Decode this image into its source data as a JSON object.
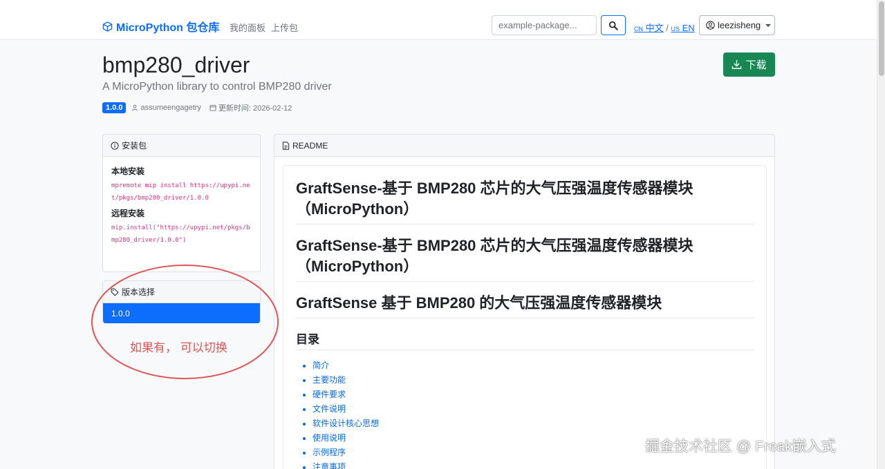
{
  "navbar": {
    "brand": "MicroPython 包仓库",
    "links": [
      "我的面板",
      "上传包"
    ],
    "search_placeholder": "example-package...",
    "lang_cn_code": "CN",
    "lang_cn_label": "中文",
    "lang_sep": "/",
    "lang_us_code": "US",
    "lang_us_label": "EN",
    "username": "leezisheng"
  },
  "package": {
    "name": "bmp280_driver",
    "description": "A MicroPython library to control BMP280 driver",
    "version": "1.0.0",
    "author": "assumeengagetry",
    "updated": "更新时间: 2026-02-12",
    "download_label": "下载"
  },
  "install": {
    "header": "安装包",
    "local_title": "本地安装",
    "local_cmd": "mpremote mip install https://upypi.net/pkgs/bmp280_driver/1.0.0",
    "remote_title": "远程安装",
    "remote_cmd": "mip.install(\"https://upypi.net/pkgs/bmp280_driver/1.0.0\")"
  },
  "versions": {
    "header": "版本选择",
    "items": [
      "1.0.0"
    ]
  },
  "readme": {
    "header": "README",
    "h1_a": "GraftSense-基于 BMP280 芯片的大气压强温度传感器模块（MicroPython）",
    "h1_b": "GraftSense-基于 BMP280 芯片的大气压强温度传感器模块（MicroPython）",
    "h1_c": "GraftSense 基于 BMP280 的大气压强温度传感器模块",
    "toc_title": "目录",
    "toc": [
      "简介",
      "主要功能",
      "硬件要求",
      "文件说明",
      "软件设计核心思想",
      "使用说明",
      "示例程序",
      "注意事项"
    ]
  },
  "annotation": {
    "text": "如果有， 可以切换"
  },
  "watermark": "掘金技术社区 @ Freak嵌入式",
  "colors": {
    "primary": "#0d6efd",
    "success": "#198754",
    "annotation": "#e05353",
    "code": "#d63384"
  }
}
